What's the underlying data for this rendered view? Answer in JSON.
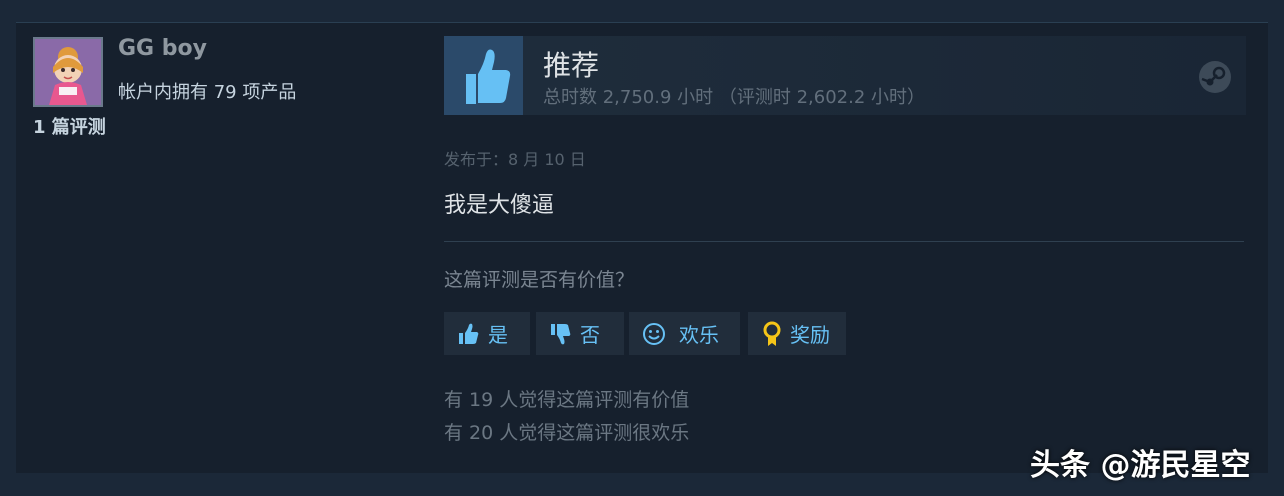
{
  "top": {
    "cut_title": "",
    "cut_meta": ""
  },
  "reviewer": {
    "name": "GG boy",
    "products_owned": "帐户内拥有 79 项产品",
    "review_count": "1 篇评测"
  },
  "review": {
    "verdict": "推荐",
    "hours": "总时数 2,750.9 小时 （评测时 2,602.2 小时）",
    "posted": "发布于：8 月 10 日",
    "content": "我是大傻逼",
    "helpful_question": "这篇评测是否有价值？"
  },
  "buttons": {
    "yes": "是",
    "no": "否",
    "funny": "欢乐",
    "award": "奖励"
  },
  "stats": {
    "helpful": "有 19 人觉得这篇评测有价值",
    "funny": "有 20 人觉得这篇评测很欢乐"
  },
  "watermark": {
    "text": "头条 @游民星空"
  },
  "icons": {
    "verdict": "thumbs-up-icon",
    "platform": "steam-icon",
    "yes": "thumbs-up-icon",
    "no": "thumbs-down-icon",
    "funny": "smiley-icon",
    "award": "award-icon"
  },
  "colors": {
    "accent": "#67c1f5",
    "background": "#1b2838",
    "card": "#16202d"
  }
}
